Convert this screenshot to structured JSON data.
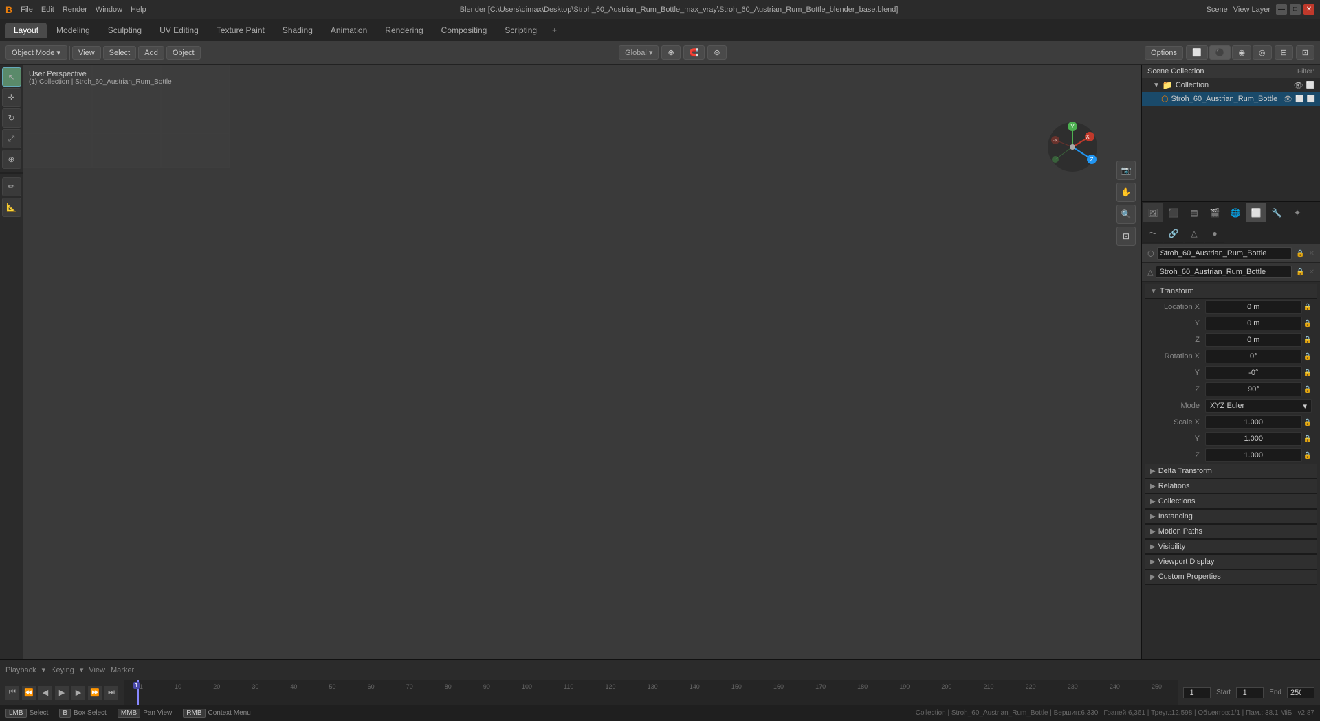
{
  "titlebar": {
    "logo": "B",
    "title": "Blender [C:\\Users\\dimax\\Desktop\\Stroh_60_Austrian_Rum_Bottle_max_vray\\Stroh_60_Austrian_Rum_Bottle_blender_base.blend]"
  },
  "workspace_tabs": {
    "tabs": [
      "Layout",
      "Modeling",
      "Sculpting",
      "UV Editing",
      "Texture Paint",
      "Shading",
      "Animation",
      "Rendering",
      "Compositing",
      "Scripting"
    ],
    "active": "Layout",
    "plus_label": "+"
  },
  "header": {
    "mode_label": "Object Mode",
    "view_label": "View",
    "select_label": "Select",
    "add_label": "Add",
    "object_label": "Object",
    "global_label": "Global",
    "options_label": "Options"
  },
  "viewport": {
    "perspective_label": "User Perspective",
    "collection_label": "(1) Collection | Stroh_60_Austrian_Rum_Bottle"
  },
  "outliner": {
    "title": "Scene Collection",
    "filter_label": "Filter:",
    "items": [
      {
        "name": "Collection",
        "type": "collection",
        "icon": "📁",
        "expanded": true
      },
      {
        "name": "Stroh_60_Austrian_Rum_Bottle",
        "type": "mesh",
        "icon": "⬡",
        "selected": true,
        "indent": 1
      }
    ]
  },
  "properties": {
    "object_name": "Stroh_60_Austrian_Rum_Bottle",
    "data_name": "Stroh_60_Austrian_Rum_Bottle",
    "transform": {
      "label": "Transform",
      "location_x": "0 m",
      "location_y": "0 m",
      "location_z": "0 m",
      "rotation_x": "0°",
      "rotation_y": "-0°",
      "rotation_z": "90°",
      "rotation_mode": "XYZ Euler",
      "scale_x": "1.000",
      "scale_y": "1.000",
      "scale_z": "1.000"
    },
    "sections": [
      {
        "name": "Delta Transform",
        "collapsed": true
      },
      {
        "name": "Relations",
        "collapsed": true
      },
      {
        "name": "Collections",
        "collapsed": true
      },
      {
        "name": "Instancing",
        "collapsed": true
      },
      {
        "name": "Motion Paths",
        "collapsed": true
      },
      {
        "name": "Visibility",
        "collapsed": true
      },
      {
        "name": "Viewport Display",
        "collapsed": true
      },
      {
        "name": "Custom Properties",
        "collapsed": true
      }
    ]
  },
  "timeline": {
    "current_frame": "1",
    "start_frame": "1",
    "end_frame": "250",
    "start_label": "Start",
    "end_label": "End",
    "frame_markers": [
      "1",
      "10",
      "20",
      "30",
      "40",
      "50",
      "60",
      "70",
      "80",
      "90",
      "100",
      "110",
      "120",
      "130",
      "140",
      "150",
      "160",
      "170",
      "180",
      "190",
      "200",
      "210",
      "220",
      "230",
      "240",
      "250"
    ]
  },
  "animation_bar": {
    "playback_label": "Playback",
    "keying_label": "Keying",
    "view_label": "View",
    "marker_label": "Marker"
  },
  "status_bar": {
    "select_label": "Select",
    "box_select_label": "Box Select",
    "pan_view_label": "Pan View",
    "context_menu_label": "Context Menu",
    "info": "Collection | Stroh_60_Austrian_Rum_Bottle | Вершин:6,330 | Граней:6,361 | Треуг.:12,598 | Объектов:1/1 | Пам.: 38.1 МіБ | v2.87"
  },
  "icons": {
    "arrow_right": "▶",
    "arrow_down": "▼",
    "lock": "🔒",
    "eye": "👁",
    "camera": "📷",
    "collection": "📁",
    "mesh": "⬡",
    "scene": "🎬",
    "render": "🖼",
    "world": "🌐",
    "object": "⬜",
    "modifier": "🔧",
    "particle": "✦",
    "physics": "〜",
    "constraints": "🔗",
    "data": "△",
    "material": "●",
    "chevron": "›"
  }
}
